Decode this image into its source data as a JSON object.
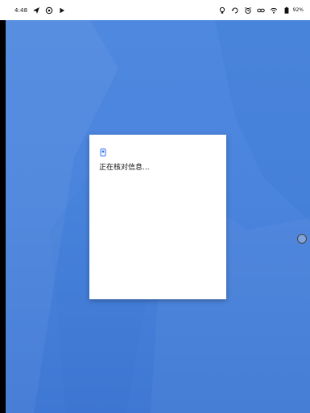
{
  "status_bar": {
    "time": "4:48",
    "battery_percent": "92%",
    "left_icons": [
      "send-icon",
      "at-icon",
      "play-icon"
    ],
    "right_icons": [
      "lightbulb-icon",
      "sync-icon",
      "alarm-icon",
      "link-icon",
      "wifi-icon",
      "battery-icon"
    ]
  },
  "dialog": {
    "message": "正在核对信息..."
  },
  "colors": {
    "wallpaper": "#4a84dd",
    "dialog_background": "#ffffff",
    "accent": "#2a6ff0"
  }
}
